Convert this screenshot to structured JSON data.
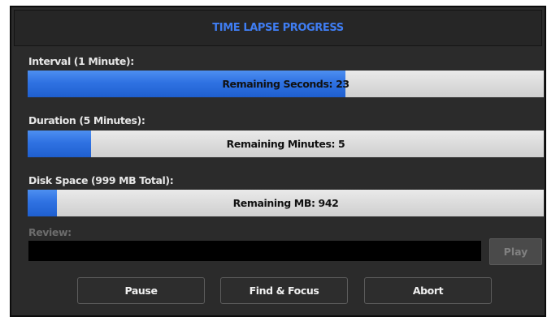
{
  "title": "TIME LAPSE PROGRESS",
  "interval": {
    "label": "Interval (1 Minute):",
    "text": "Remaining Seconds: 23",
    "progress": 0.615
  },
  "duration": {
    "label": "Duration (5 Minutes):",
    "text": "Remaining Minutes: 5",
    "progress": 0.123
  },
  "disk": {
    "label": "Disk Space (999 MB Total):",
    "text": "Remaining MB: 942",
    "progress": 0.057
  },
  "review": {
    "label": "Review:",
    "play_label": "Play"
  },
  "buttons": {
    "pause": "Pause",
    "find_focus": "Find & Focus",
    "abort": "Abort"
  },
  "colors": {
    "accent": "#3f7df2",
    "panel_bg": "#2b2b2b",
    "progress_fill": "#2f72e2",
    "progress_track": "#d9d9d9"
  }
}
